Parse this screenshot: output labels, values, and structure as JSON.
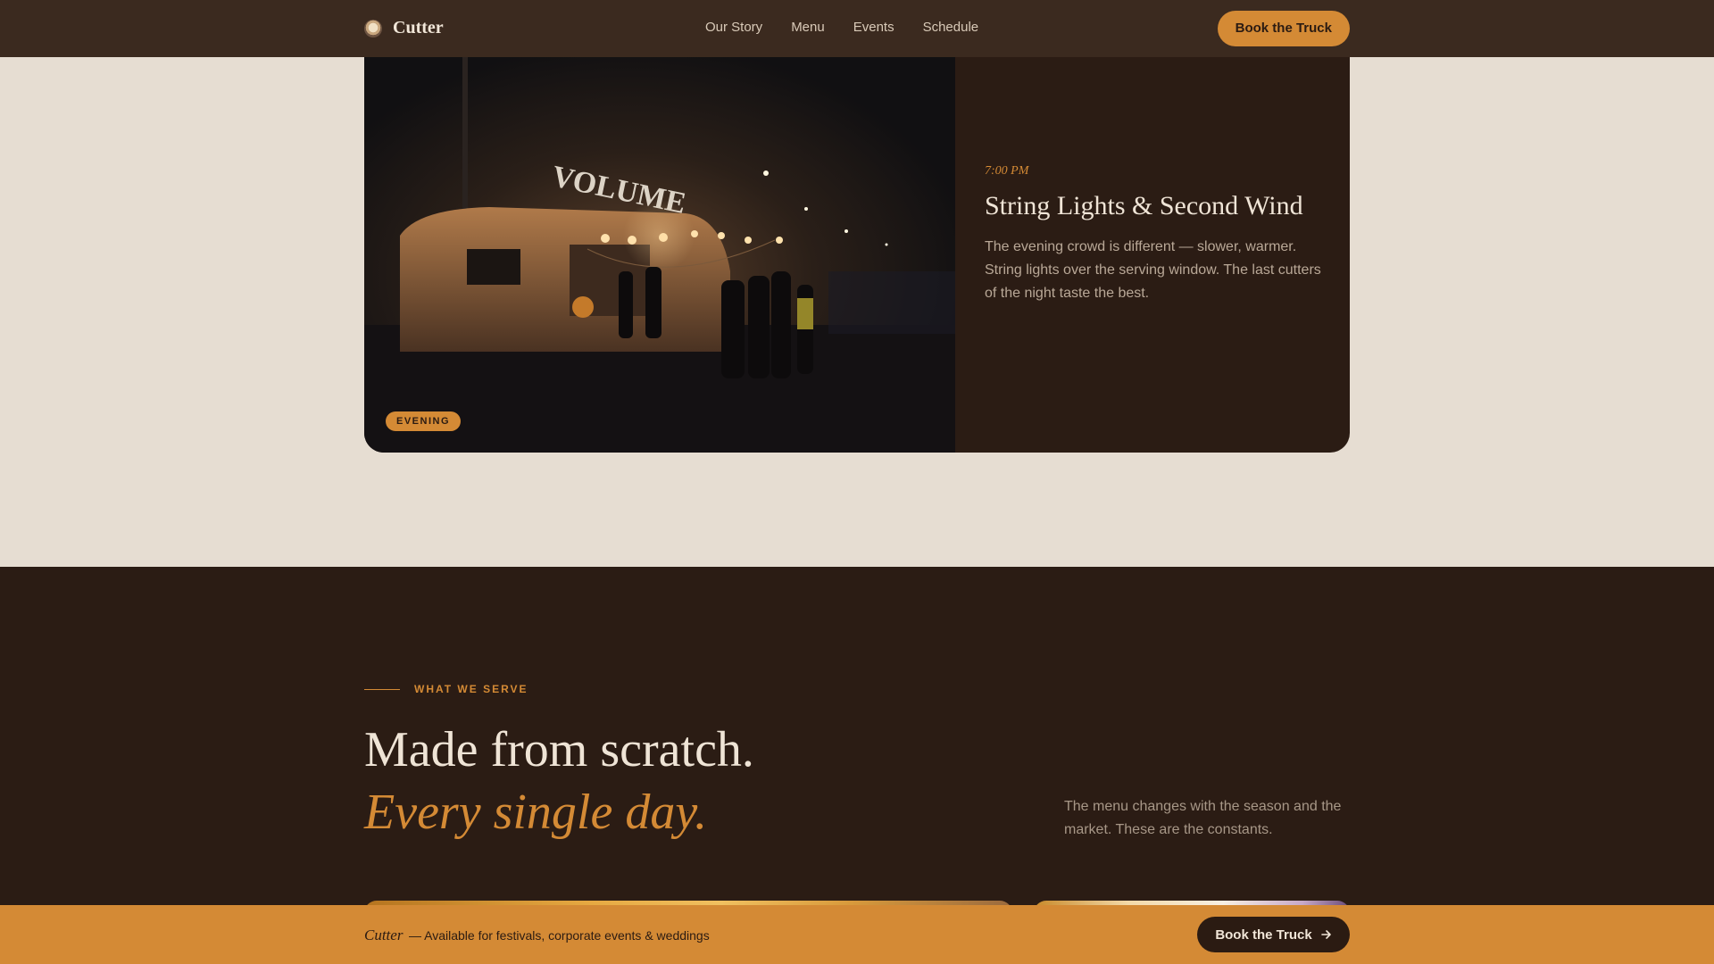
{
  "nav": {
    "brand": "Cutter",
    "links": [
      "Our Story",
      "Menu",
      "Events",
      "Schedule"
    ],
    "cta": "Book the Truck"
  },
  "hero_card": {
    "photo_sign": "VOLUME",
    "badge": "EVENING",
    "time": "7:00 PM",
    "title": "String Lights & Second Wind",
    "body": "The evening crowd is different — slower, warmer. String lights over the serving window. The last cutters of the night taste the best."
  },
  "serve": {
    "eyebrow": "WHAT WE SERVE",
    "headline": "Made from scratch.",
    "headline_em": "Every single day.",
    "description": "The menu changes with the season and the market. These are the constants."
  },
  "sticky_bar": {
    "brand": "Cutter",
    "text": "— Available for festivals, corporate events & weddings",
    "cta": "Book the Truck",
    "cta_icon": "arrow-right-icon"
  },
  "colors": {
    "accent": "#d48a35",
    "dark": "#2b1c14",
    "nav": "#3b2a1f",
    "page": "#e6ddd2"
  }
}
